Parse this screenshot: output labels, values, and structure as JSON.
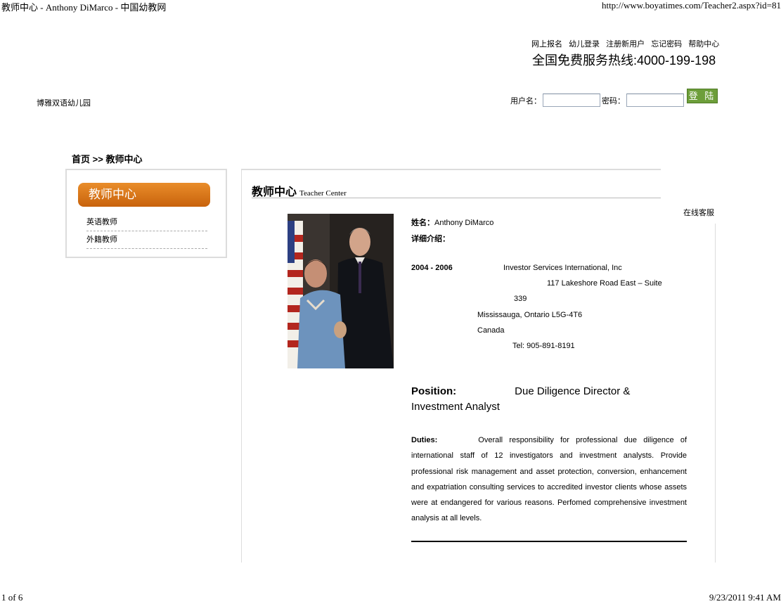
{
  "print_header": {
    "title": "教师中心 - Anthony DiMarco - 中国幼教网",
    "url": "http://www.boyatimes.com/Teacher2.aspx?id=81"
  },
  "print_footer": {
    "page": "1 of 6",
    "datetime": "9/23/2011 9:41 AM"
  },
  "top_links": [
    "网上报名",
    "幼儿登录",
    "注册新用户",
    "忘记密码",
    "帮助中心"
  ],
  "hotline": "全国免费服务热线:4000-199-198",
  "site_name": "博雅双语幼儿园",
  "login": {
    "username_label": "用户名：",
    "password_label": "密码：",
    "username_value": "",
    "password_value": "",
    "button_label": "登 陆"
  },
  "breadcrumb": {
    "home": "首页",
    "separator": ">>",
    "current": "教师中心"
  },
  "sidebar": {
    "title": "教师中心",
    "items": [
      "英语教师",
      "外籍教师"
    ]
  },
  "section": {
    "title_cn": "教师中心",
    "title_en": "Teacher Center"
  },
  "online_service": "在线客服",
  "teacher": {
    "name_label": "姓名：",
    "name": "Anthony DiMarco",
    "detail_label": "详细介绍：",
    "period": "2004 - 2006",
    "company": "Investor Services International, Inc",
    "address_1": "117 Lakeshore Road East – Suite",
    "address_2": "339",
    "city": "Mississauga, Ontario L5G-4T6",
    "country": "Canada",
    "tel": "Tel: 905-891-8191",
    "position_label": "Position:",
    "position_value": "Due Diligence Director &",
    "position_value_2": "Investment Analyst",
    "duties_label": "Duties:",
    "duties_text": "Overall responsibility for professional due diligence of international staff of 12 investigators and investment analysts. Provide professional risk management and asset protection, conversion, enhancement and expatriation consulting services to accredited investor clients whose assets were at endangered for various reasons. Perfomed comprehensive investment analysis at all levels."
  },
  "colors": {
    "sidebar_header": "#d9761a",
    "login_button": "#6d9e3a"
  }
}
